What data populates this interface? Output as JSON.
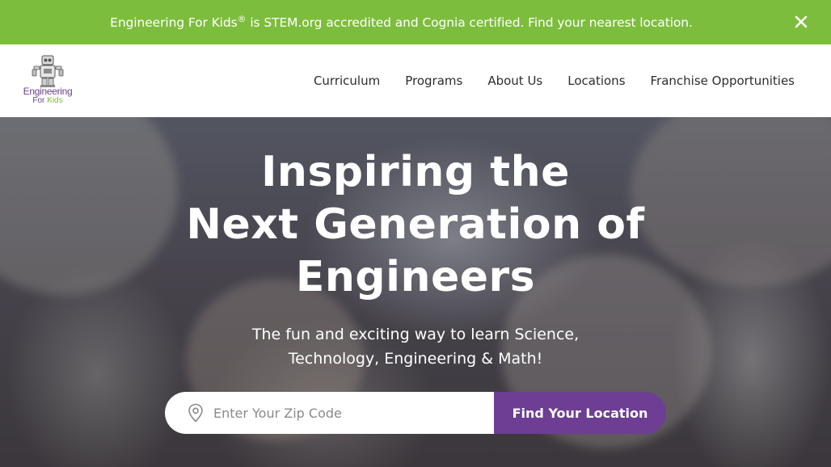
{
  "banner": {
    "brand": "Engineering For Kids",
    "registered": "®",
    "message": " is STEM.org accredited and Cognia certified. Find your nearest location.",
    "close_icon": "close-icon"
  },
  "logo": {
    "line1": "Engineering",
    "line2_for": "For ",
    "line2_kids": "Kids",
    "icon": "robot-icon"
  },
  "nav": {
    "items": [
      {
        "label": "Curriculum"
      },
      {
        "label": "Programs"
      },
      {
        "label": "About Us"
      },
      {
        "label": "Locations"
      },
      {
        "label": "Franchise Opportunities"
      }
    ]
  },
  "hero": {
    "title_lines": [
      "Inspiring the",
      "Next Generation of",
      "Engineers"
    ],
    "subtitle_lines": [
      "The fun and exciting way to learn Science,",
      "Technology, Engineering & Math!"
    ],
    "search": {
      "placeholder": "Enter Your Zip Code",
      "value": "",
      "icon": "location-pin-icon",
      "button_label": "Find Your Location"
    }
  },
  "colors": {
    "banner": "#7dbd3d",
    "brand_purple": "#6d3e94",
    "brand_green": "#7dbd3d",
    "nav_text": "#2d2d2d"
  }
}
